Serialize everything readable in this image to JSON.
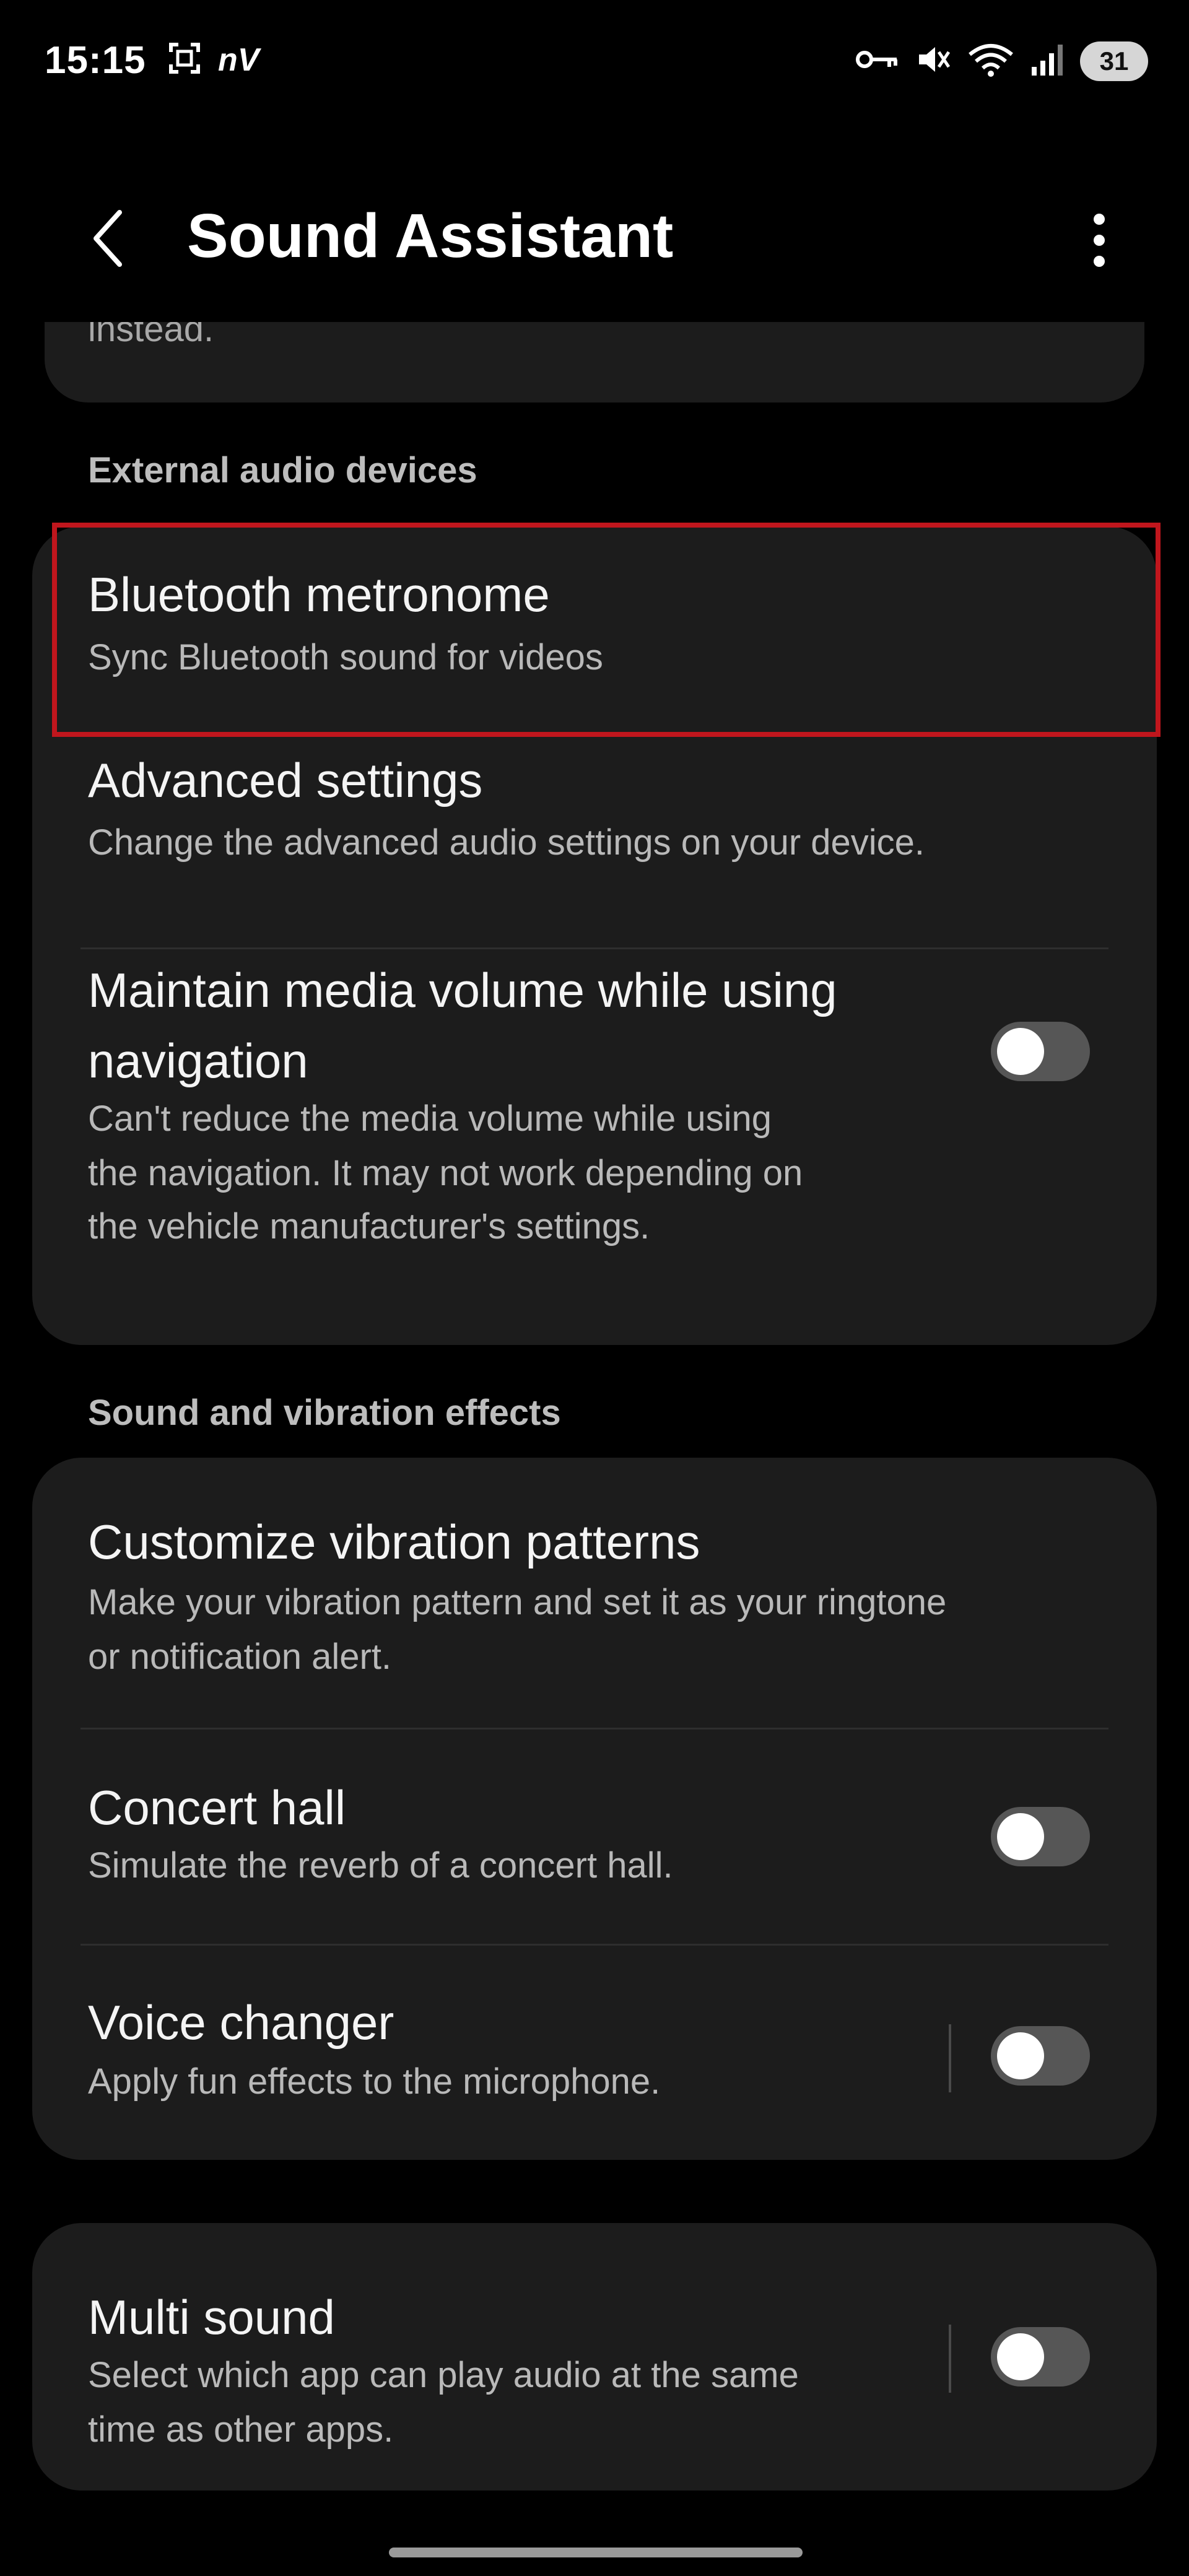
{
  "status_bar": {
    "time": "15:15",
    "left_icons": [
      "screenshot-icon",
      "network-nv-icon"
    ],
    "left_text": "nV",
    "right_icons": [
      "vpn-key-icon",
      "mute-icon",
      "wifi-icon",
      "signal-icon"
    ],
    "battery": "31"
  },
  "header": {
    "title": "Sound Assistant"
  },
  "partial_card": {
    "text": "instead."
  },
  "sections": {
    "external": "External audio devices",
    "effects": "Sound and vibration effects"
  },
  "items": {
    "bt_metronome": {
      "title": "Bluetooth metronome",
      "subtitle": "Sync Bluetooth sound for videos"
    },
    "advanced": {
      "title": "Advanced settings",
      "subtitle": "Change the advanced audio settings on your device."
    },
    "maintain": {
      "title_line1": "Maintain media volume while using",
      "title_line2": "navigation",
      "sub_line1": "Can't reduce the media volume while using",
      "sub_line2": "the navigation. It may not work depending on",
      "sub_line3": "the vehicle manufacturer's settings.",
      "enabled": false
    },
    "vibration": {
      "title": "Customize vibration patterns",
      "sub_line1": "Make your vibration pattern and set it as your ringtone",
      "sub_line2": "or notification alert."
    },
    "concert": {
      "title": "Concert hall",
      "subtitle": "Simulate the reverb of a concert hall.",
      "enabled": false
    },
    "voice": {
      "title": "Voice changer",
      "subtitle": "Apply fun effects to the microphone.",
      "enabled": false
    },
    "multi": {
      "title": "Multi sound",
      "sub_line1": "Select which app can play audio at the same",
      "sub_line2": "time as other apps.",
      "enabled": false
    }
  },
  "colors": {
    "background": "#000000",
    "card": "#1c1c1c",
    "highlight": "#c0161d",
    "toggle_off": "#565656"
  }
}
